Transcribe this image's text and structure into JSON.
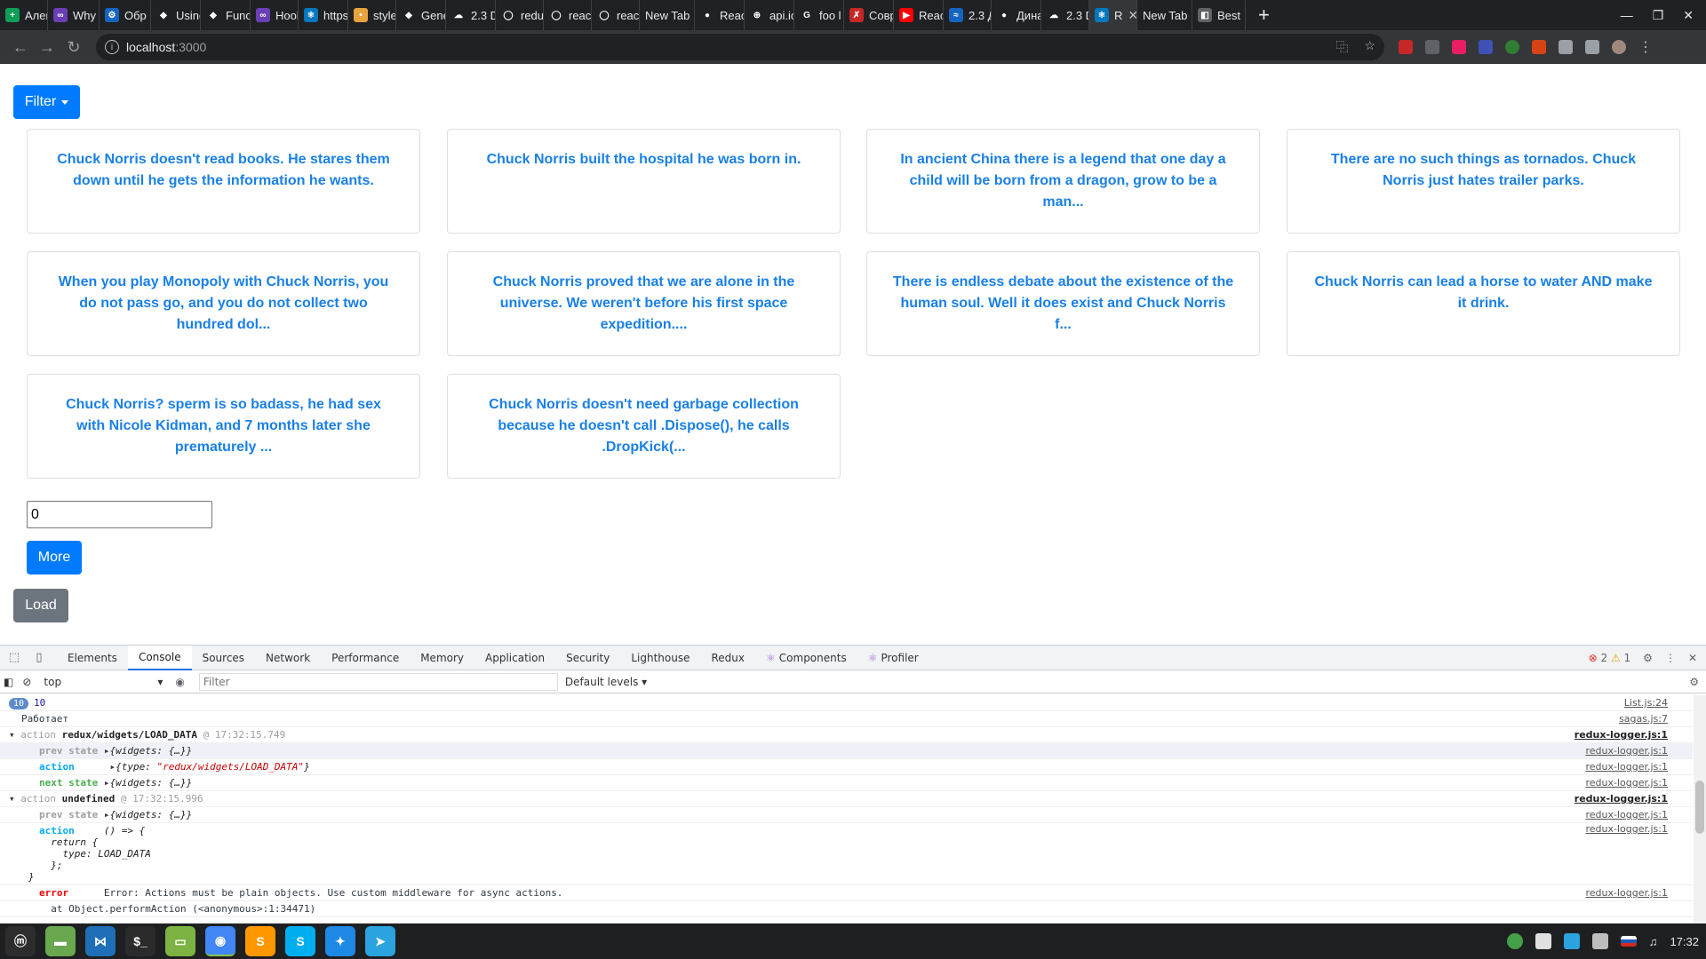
{
  "browser": {
    "tabs": [
      {
        "title": "Алек",
        "color": "#0f9d58",
        "glyph": "+"
      },
      {
        "title": "Why",
        "color": "#6a3fb5",
        "glyph": "∞"
      },
      {
        "title": "Обр",
        "color": "#1565c0",
        "glyph": "⚙"
      },
      {
        "title": "Using",
        "color": "#202124",
        "glyph": "◆"
      },
      {
        "title": "Func",
        "color": "#202124",
        "glyph": "◆"
      },
      {
        "title": "Hool",
        "color": "#6a3fb5",
        "glyph": "∞"
      },
      {
        "title": "https",
        "color": "#0277bd",
        "glyph": "⚛"
      },
      {
        "title": "style",
        "color": "#e8a33d",
        "glyph": "•"
      },
      {
        "title": "Gene",
        "color": "#202124",
        "glyph": "◆"
      },
      {
        "title": "2.3 D",
        "color": "#202124",
        "glyph": "☁"
      },
      {
        "title": "redu",
        "color": "#202124",
        "glyph": "◯"
      },
      {
        "title": "react",
        "color": "#202124",
        "glyph": "◯"
      },
      {
        "title": "react",
        "color": "#202124",
        "glyph": "◯"
      },
      {
        "title": "New Tab",
        "color": "",
        "glyph": ""
      },
      {
        "title": "Reac",
        "color": "#202124",
        "glyph": "●"
      },
      {
        "title": "api.ic",
        "color": "#202124",
        "glyph": "⊕"
      },
      {
        "title": "foo l",
        "color": "#202124",
        "glyph": "G"
      },
      {
        "title": "Совр",
        "color": "#c62828",
        "glyph": "✗"
      },
      {
        "title": "Reac",
        "color": "#ff0000",
        "glyph": "▶"
      },
      {
        "title": "2.3 Д",
        "color": "#1565c0",
        "glyph": "≈"
      },
      {
        "title": "Дина",
        "color": "#202124",
        "glyph": "●"
      },
      {
        "title": "2.3 D",
        "color": "#202124",
        "glyph": "☁"
      },
      {
        "title": "R",
        "color": "#0277bd",
        "glyph": "⚛"
      },
      {
        "title": "New Tab",
        "color": "",
        "glyph": ""
      },
      {
        "title": "Best",
        "color": "#5f6368",
        "glyph": "◧"
      }
    ],
    "active_tab_index": 22,
    "url_host": "localhost",
    "url_port": ":3000"
  },
  "page": {
    "filter_label": "Filter",
    "cards": [
      "Chuck Norris doesn't read books. He stares them down until he gets the information he wants.",
      "Chuck Norris built the hospital he was born in.",
      "In ancient China there is a legend that one day a child will be born from a dragon, grow to be a man...",
      "There are no such things as tornados. Chuck Norris just hates trailer parks.",
      "When you play Monopoly with Chuck Norris, you do not pass go, and you do not collect two hundred dol...",
      "Chuck Norris proved that we are alone in the universe. We weren't before his first space expedition....",
      "There is endless debate about the existence of the human soul. Well it does exist and Chuck Norris f...",
      "Chuck Norris can lead a horse to water AND make it drink.",
      "Chuck Norris? sperm is so badass, he had sex with Nicole Kidman, and 7 months later she prematurely ...",
      "Chuck Norris doesn't need garbage collection because he doesn't call .Dispose(), he calls .DropKick(..."
    ],
    "count_value": "0",
    "more_label": "More",
    "load_label": "Load"
  },
  "devtools": {
    "tabs": [
      "Elements",
      "Console",
      "Sources",
      "Network",
      "Performance",
      "Memory",
      "Application",
      "Security",
      "Lighthouse",
      "Redux",
      "Components",
      "Profiler"
    ],
    "active_tab": "Console",
    "error_count": "2",
    "warning_count": "1",
    "context": "top",
    "filter_placeholder": "Filter",
    "levels": "Default levels",
    "console": {
      "count_badge": "10",
      "count_value": "10",
      "count_src": "List.js:24",
      "works_text": "Работает",
      "works_src": "sagas.js:7",
      "group1_prefix": "action",
      "group1_type": "redux/widgets/LOAD_DATA",
      "group1_time": "@ 17:32:15.749",
      "group2_prefix": "action",
      "group2_type": "undefined",
      "group2_time": "@ 17:32:15.996",
      "logger_src": "redux-logger.js:1",
      "prev_label": "prev state",
      "prev_value": "{widgets: {…}}",
      "action_label": "action",
      "action_open": "{type: ",
      "action_string": "\"redux/widgets/LOAD_DATA\"",
      "action_close": "}",
      "next_label": "next state",
      "next_value": "{widgets: {…}}",
      "action2_line1": "() => {",
      "action2_line2": "return {",
      "action2_line3": "type: LOAD_DATA",
      "action2_line4": "};",
      "action2_line5": "}",
      "error_label": "error",
      "error_text": "Error: Actions must be plain objects. Use custom middleware for async actions.",
      "error_trace": "at Object.performAction (<anonymous>:1:34471)"
    }
  },
  "taskbar": {
    "apps": [
      {
        "name": "mint-menu",
        "color": "#2d2d2d",
        "glyph": "ⓜ"
      },
      {
        "name": "files",
        "color": "#6aa84f",
        "glyph": "▬"
      },
      {
        "name": "vscode",
        "color": "#1e6fb8",
        "glyph": "⋈"
      },
      {
        "name": "terminal",
        "color": "#2b2b2b",
        "glyph": "$_"
      },
      {
        "name": "folder",
        "color": "#7cb342",
        "glyph": "▭"
      },
      {
        "name": "chrome",
        "color": "#4285f4",
        "glyph": "◉"
      },
      {
        "name": "sublime",
        "color": "#ff9800",
        "glyph": "S"
      },
      {
        "name": "skype",
        "color": "#00aff0",
        "glyph": "S"
      },
      {
        "name": "network",
        "color": "#1e88e5",
        "glyph": "✦"
      },
      {
        "name": "telegram",
        "color": "#2aa3df",
        "glyph": "➤"
      }
    ],
    "clock": "17:32"
  }
}
